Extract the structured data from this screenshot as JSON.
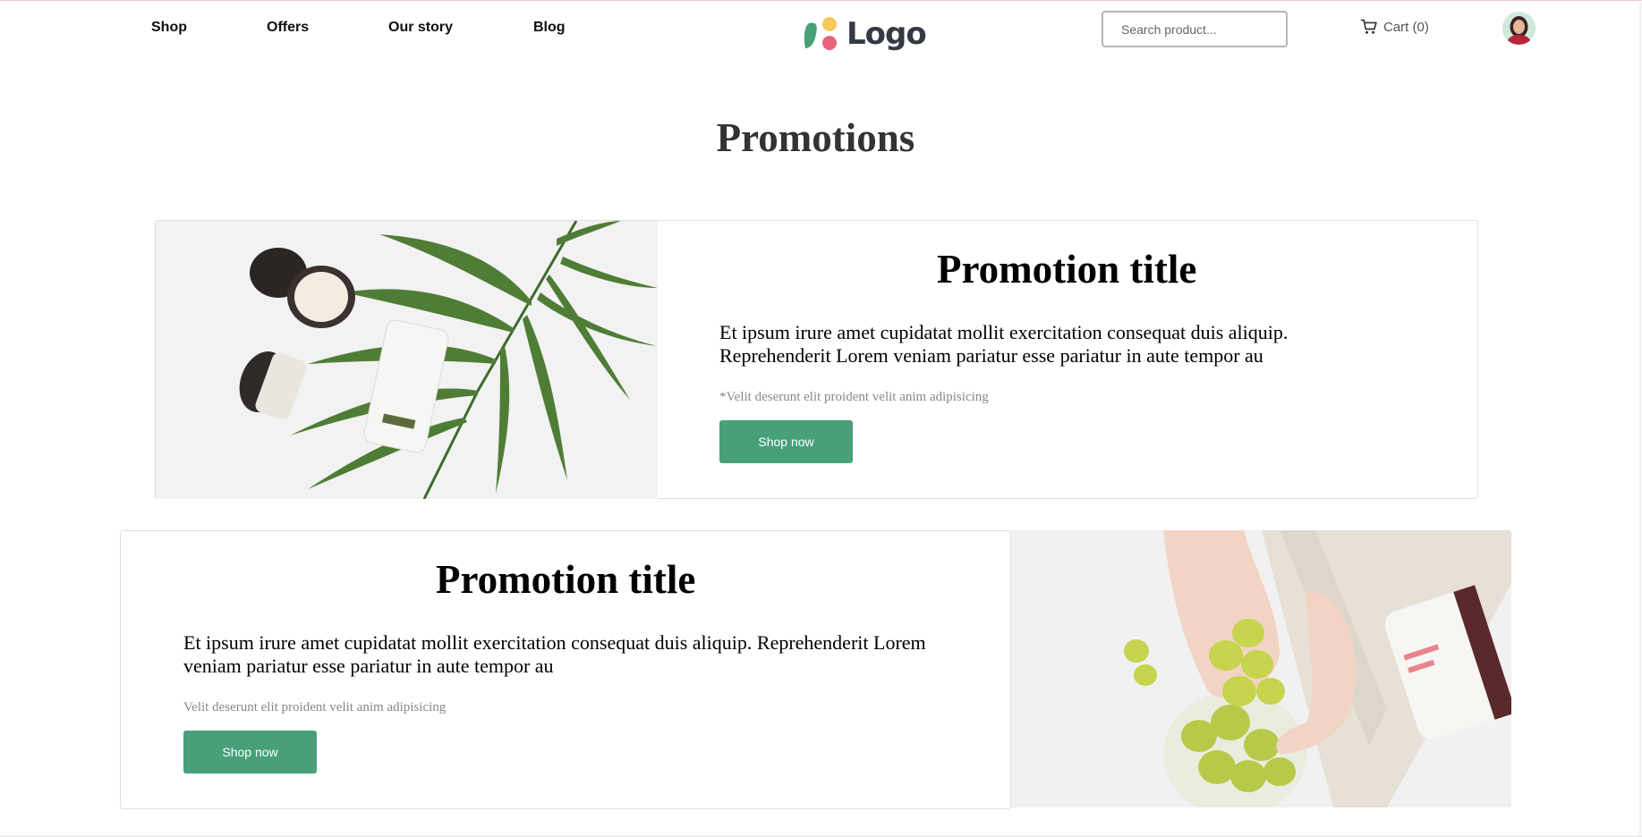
{
  "nav": {
    "items": [
      {
        "label": "Shop"
      },
      {
        "label": "Offers"
      },
      {
        "label": "Our story"
      },
      {
        "label": "Blog"
      }
    ]
  },
  "logo": {
    "text": "Logo",
    "colors": {
      "leaf": "#48a07a",
      "dot_top": "#f7c85a",
      "dot_bottom": "#e8647d"
    }
  },
  "search": {
    "placeholder": "Search product..."
  },
  "cart": {
    "label": "Cart (0)",
    "icon": "cart-icon"
  },
  "page": {
    "title": "Promotions"
  },
  "promotions": [
    {
      "title": "Promotion title",
      "text": "Et ipsum irure amet cupidatat mollit exercitation consequat duis aliquip. Reprehenderit Lorem veniam pariatur esse pariatur in aute tempor au",
      "note": "*Velit deserunt elit proident velit anim adipisicing",
      "button": "Shop now"
    },
    {
      "title": "Promotion title",
      "text": "Et ipsum irure amet cupidatat mollit exercitation consequat duis aliquip. Reprehenderit Lorem veniam pariatur esse pariatur in aute tempor au",
      "note": "Velit deserunt elit proident velit anim adipisicing",
      "button": "Shop now"
    }
  ],
  "colors": {
    "accent": "#48a07a",
    "title": "#333333",
    "muted": "#888888"
  }
}
